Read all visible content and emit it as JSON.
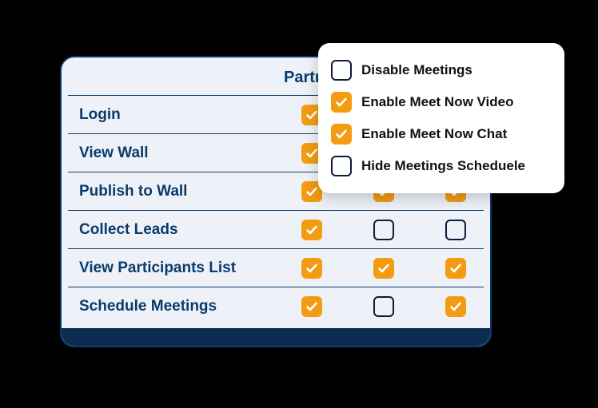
{
  "table": {
    "column": "Partner",
    "rows": [
      {
        "label": "Login",
        "cells": [
          true,
          true,
          true
        ]
      },
      {
        "label": "View Wall",
        "cells": [
          true,
          true,
          true
        ]
      },
      {
        "label": "Publish to Wall",
        "cells": [
          true,
          true,
          true
        ]
      },
      {
        "label": "Collect Leads",
        "cells": [
          true,
          false,
          false
        ]
      },
      {
        "label": "View Participants List",
        "cells": [
          true,
          true,
          true
        ]
      },
      {
        "label": "Schedule Meetings",
        "cells": [
          true,
          false,
          true
        ]
      }
    ]
  },
  "dropdown": {
    "items": [
      {
        "label": "Disable Meetings",
        "checked": false
      },
      {
        "label": "Enable Meet Now Video",
        "checked": true
      },
      {
        "label": "Enable Meet Now Chat",
        "checked": true
      },
      {
        "label": "Hide Meetings Scheduele",
        "checked": false
      }
    ]
  }
}
